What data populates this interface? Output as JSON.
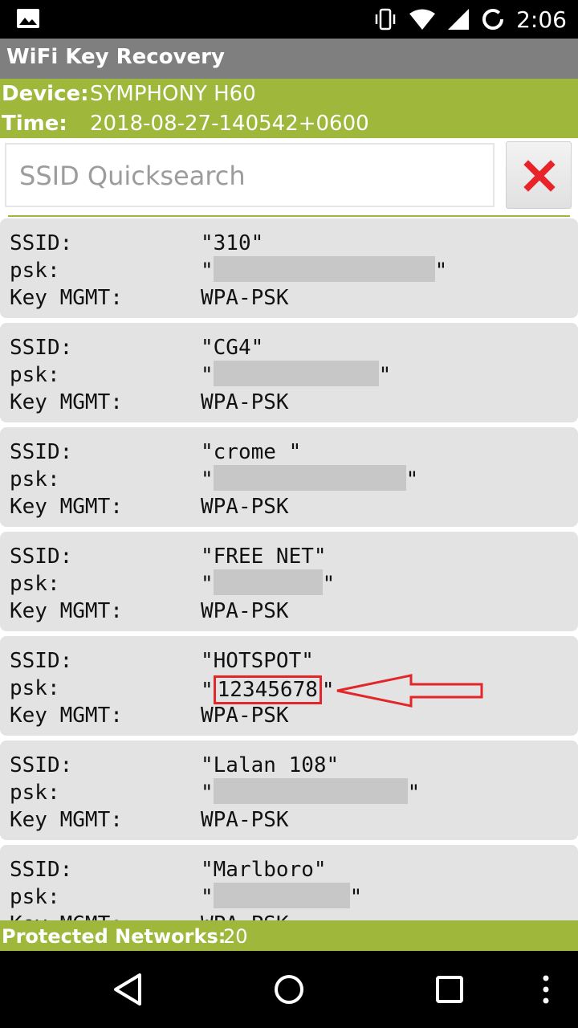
{
  "status_bar": {
    "time": "2:06",
    "icons": [
      "image-icon",
      "vibrate-icon",
      "wifi-icon",
      "signal-icon",
      "battery-icon"
    ]
  },
  "app_bar": {
    "title": "WiFi Key Recovery"
  },
  "device_info": {
    "device_label": "Device:",
    "device_value": "SYMPHONY H60",
    "time_label": "Time:",
    "time_value": "2018-08-27-140542+0600"
  },
  "search": {
    "placeholder": "SSID Quicksearch",
    "clear_icon": "clear-x-icon"
  },
  "labels": {
    "ssid": "SSID:",
    "psk": "psk:",
    "key_mgmt": "Key MGMT:"
  },
  "networks": [
    {
      "ssid": "\"310\"",
      "psk_redacted": true,
      "key_mgmt": "WPA-PSK"
    },
    {
      "ssid": "\"CG4\"",
      "psk_redacted": true,
      "key_mgmt": "WPA-PSK"
    },
    {
      "ssid": "\"crome \"",
      "psk_redacted": true,
      "key_mgmt": "WPA-PSK"
    },
    {
      "ssid": "\"FREE NET\"",
      "psk_redacted": true,
      "key_mgmt": "WPA-PSK"
    },
    {
      "ssid": "\"HOTSPOT\"",
      "psk": "12345678",
      "psk_redacted": false,
      "key_mgmt": "WPA-PSK",
      "highlighted": true
    },
    {
      "ssid": "\"Lalan 108\"",
      "psk_redacted": true,
      "key_mgmt": "WPA-PSK"
    },
    {
      "ssid": "\"Marlboro\"",
      "psk_redacted": true,
      "key_mgmt": "WPA-PSK"
    }
  ],
  "footer": {
    "label": "Protected Networks:",
    "count": "20"
  },
  "colors": {
    "accent": "#9fb83c",
    "app_bar": "#7f7f7f",
    "card": "#e3e3e3",
    "highlight": "#e2262a",
    "clear_icon": "#e8232a"
  },
  "nav_bar": {
    "icons": [
      "back-icon",
      "home-icon",
      "recents-icon",
      "more-icon"
    ]
  }
}
